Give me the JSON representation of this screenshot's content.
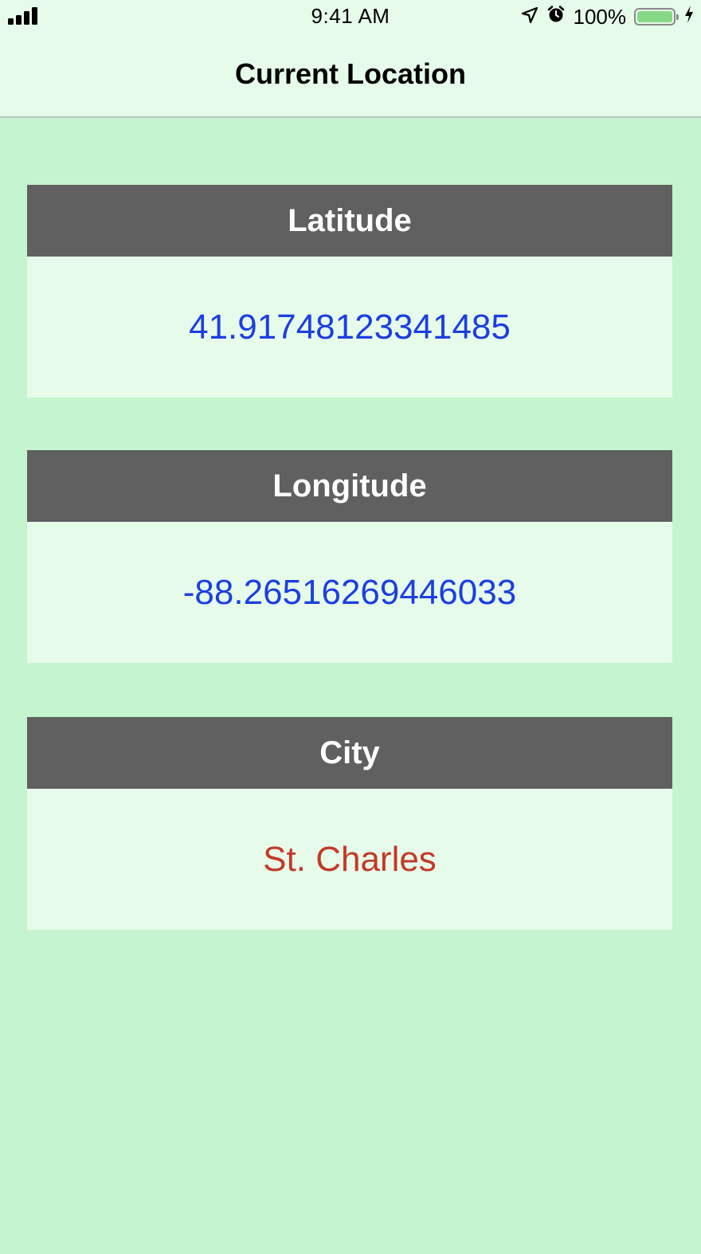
{
  "status_bar": {
    "time": "9:41 AM",
    "battery_percent": "100%",
    "battery_level": 1.0,
    "icons": [
      "signal-icon",
      "location-arrow-icon",
      "alarm-icon",
      "battery-icon",
      "charging-bolt-icon"
    ]
  },
  "nav": {
    "title": "Current Location"
  },
  "cards": [
    {
      "label": "Latitude",
      "value": "41.91748123341485",
      "value_color": "#1b3fe0"
    },
    {
      "label": "Longitude",
      "value": "-88.26516269446033",
      "value_color": "#1b3fe0"
    },
    {
      "label": "City",
      "value": "St. Charles",
      "value_color": "#c23a28"
    }
  ],
  "colors": {
    "background": "#c5f5cf",
    "header_bg": "#606060",
    "card_body_bg": "#e7fbea"
  }
}
